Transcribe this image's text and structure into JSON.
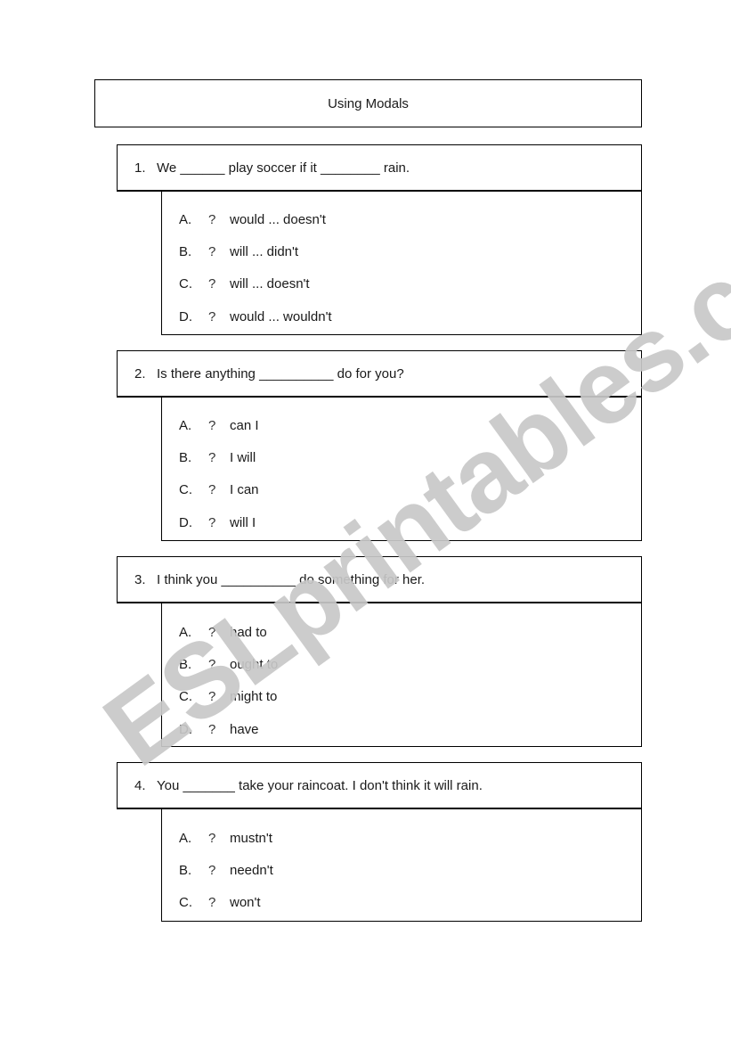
{
  "title": "Using Modals",
  "watermark": "ESLprintables.com",
  "questions": [
    {
      "number": "1.",
      "text": "We ______ play soccer if it ________ rain.",
      "options": [
        {
          "letter": "A.",
          "mark": "?",
          "text": "would ... doesn't"
        },
        {
          "letter": "B.",
          "mark": "?",
          "text": "will ... didn't"
        },
        {
          "letter": "C.",
          "mark": "?",
          "text": "will ... doesn't"
        },
        {
          "letter": "D.",
          "mark": "?",
          "text": "would ... wouldn't"
        }
      ]
    },
    {
      "number": "2.",
      "text": "Is there anything __________ do for you?",
      "options": [
        {
          "letter": "A.",
          "mark": "?",
          "text": "can I"
        },
        {
          "letter": "B.",
          "mark": "?",
          "text": "I will"
        },
        {
          "letter": "C.",
          "mark": "?",
          "text": "I can"
        },
        {
          "letter": "D.",
          "mark": "?",
          "text": "will I"
        }
      ]
    },
    {
      "number": "3.",
      "text": "I think you __________ do something for her.",
      "options": [
        {
          "letter": "A.",
          "mark": "?",
          "text": "had to"
        },
        {
          "letter": "B.",
          "mark": "?",
          "text": "ought to"
        },
        {
          "letter": "C.",
          "mark": "?",
          "text": "might to"
        },
        {
          "letter": "D.",
          "mark": "?",
          "text": "have"
        }
      ]
    },
    {
      "number": "4.",
      "text": "You _______ take your raincoat. I don't think it will rain.",
      "options": [
        {
          "letter": "A.",
          "mark": "?",
          "text": "mustn't"
        },
        {
          "letter": "B.",
          "mark": "?",
          "text": "needn't"
        },
        {
          "letter": "C.",
          "mark": "?",
          "text": "won't"
        }
      ]
    }
  ]
}
